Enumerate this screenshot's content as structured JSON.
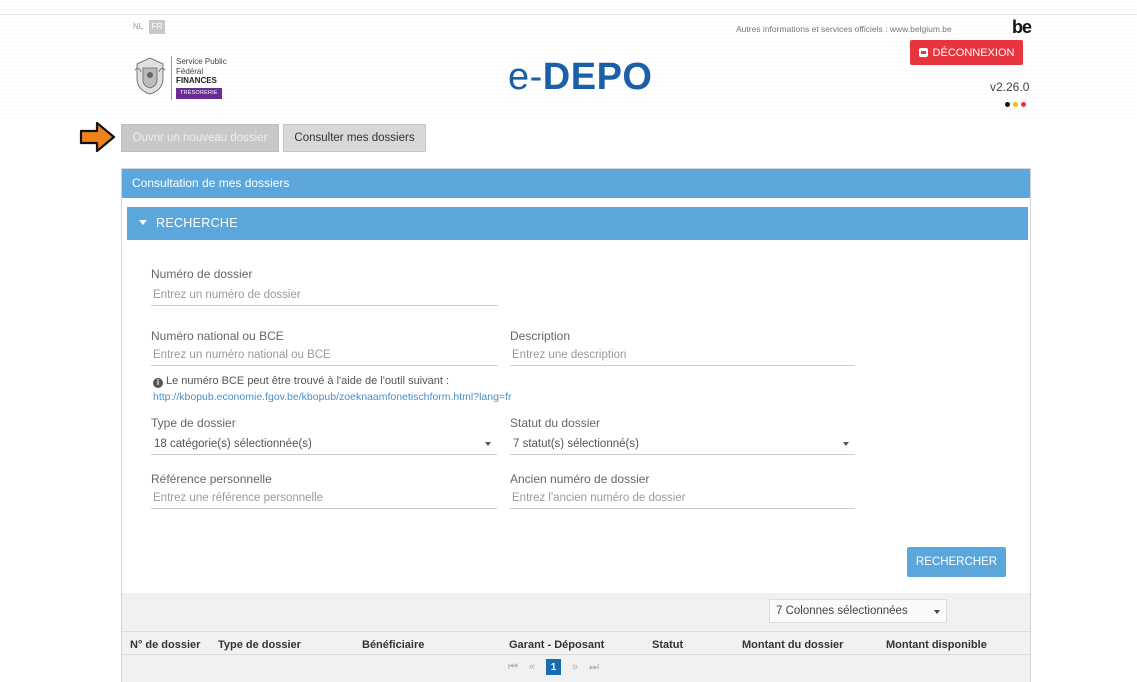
{
  "header": {
    "lang_nl": "NL",
    "lang_fr": "FR",
    "other_info": "Autres informations et services officiels : www.belgium.be",
    "be_logo": "be",
    "logout_label": "DÉCONNEXION",
    "version": "v2.26.0",
    "flag_colors": [
      "#111111",
      "#f2c200",
      "#e8343e"
    ]
  },
  "org": {
    "line1": "Service Public",
    "line2": "Fédéral",
    "line3": "FINANCES",
    "badge": "TRÉSORERIE"
  },
  "app_title": {
    "prefix": "e-",
    "main": "DEPO"
  },
  "nav": {
    "new_dossier": "Ouvrir un nouveau dossier",
    "consult_dossiers": "Consulter mes dossiers"
  },
  "panel": {
    "title": "Consultation de mes dossiers",
    "search_title": "RECHERCHE"
  },
  "form": {
    "numero_dossier": {
      "label": "Numéro de dossier",
      "placeholder": "Entrez un numéro de dossier"
    },
    "numero_national": {
      "label": "Numéro national ou BCE",
      "placeholder": "Entrez un numéro national ou BCE"
    },
    "description": {
      "label": "Description",
      "placeholder": "Entrez une description"
    },
    "bce_info": "Le numéro BCE peut être trouvé à l'aide de l'outil suivant :",
    "bce_link": "http://kbopub.economie.fgov.be/kbopub/zoeknaamfonetischform.html?lang=fr",
    "type_dossier": {
      "label": "Type de dossier",
      "value": "18 catégorie(s) sélectionnée(s)"
    },
    "statut_dossier": {
      "label": "Statut du dossier",
      "value": "7 statut(s) sélectionné(s)"
    },
    "reference": {
      "label": "Référence personnelle",
      "placeholder": "Entrez une référence personnelle"
    },
    "ancien_numero": {
      "label": "Ancien numéro de dossier",
      "placeholder": "Entrez l'ancien numéro de dossier"
    },
    "search_button": "RECHERCHER"
  },
  "table": {
    "columns_select": "7 Colonnes sélectionnées",
    "headers": [
      "N° de dossier",
      "Type de dossier",
      "Bénéficiaire",
      "Garant - Déposant",
      "Statut",
      "Montant du dossier",
      "Montant disponible"
    ],
    "pager": {
      "first": "⏮",
      "prev": "«",
      "current": "1",
      "next": "»",
      "last": "⏭"
    }
  },
  "colors": {
    "accent_blue": "#5ba7dc",
    "title_blue": "#1b5fa6",
    "logout_red": "#e8343e",
    "arrow_orange": "#f0821e"
  }
}
